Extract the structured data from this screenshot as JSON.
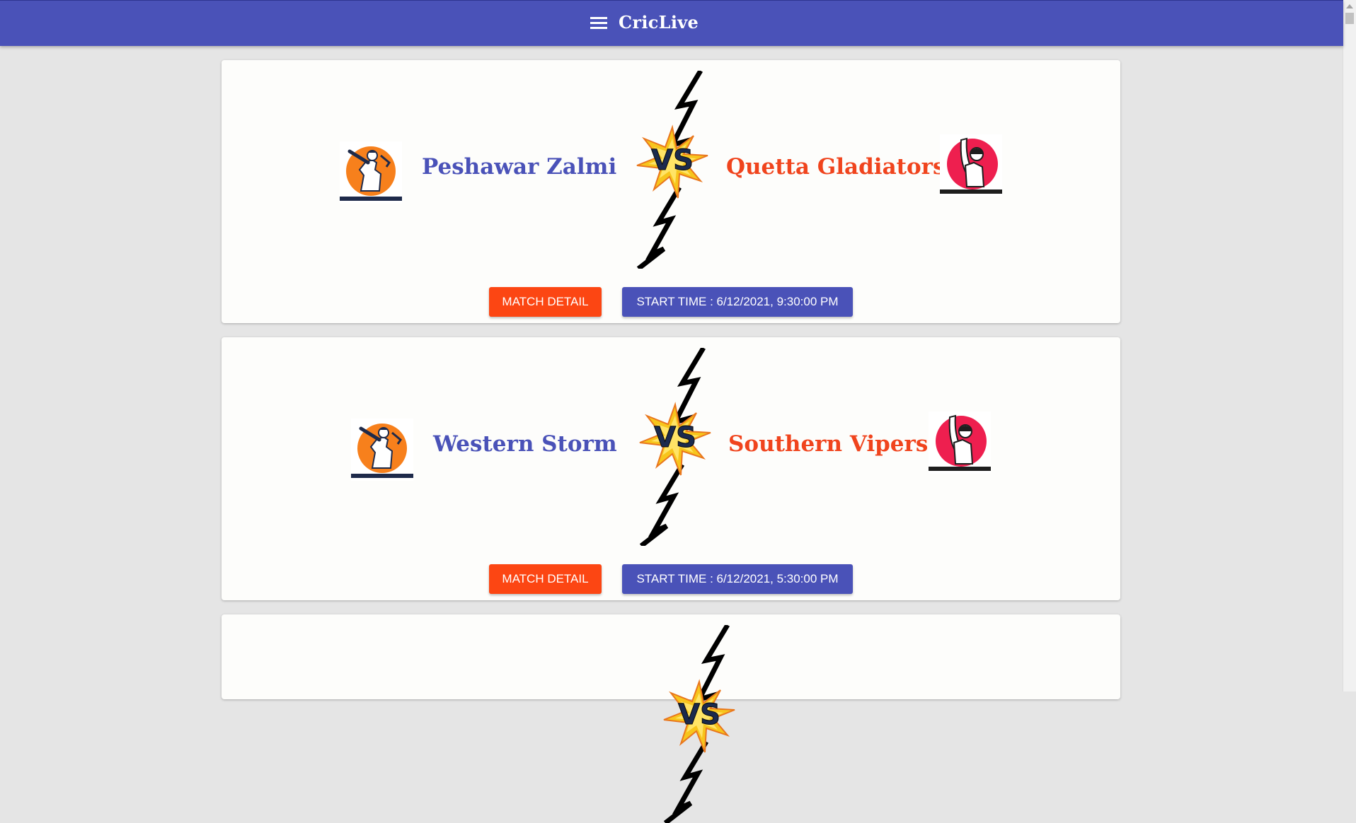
{
  "app": {
    "title": "CricLive",
    "menu_icon": "hamburger-menu-icon",
    "primary_color": "#4a52b8",
    "accent_color": "#fc4613"
  },
  "matches": [
    {
      "team1": "Peshawar Zalmi",
      "team2": "Quetta Gladiators",
      "detail_label": "MATCH DETAIL",
      "start_time_label": "START TIME : 6/12/2021, 9:30:00 PM"
    },
    {
      "team1": "Western Storm",
      "team2": "Southern Vipers",
      "detail_label": "MATCH DETAIL",
      "start_time_label": "START TIME : 6/12/2021, 5:30:00 PM"
    }
  ]
}
